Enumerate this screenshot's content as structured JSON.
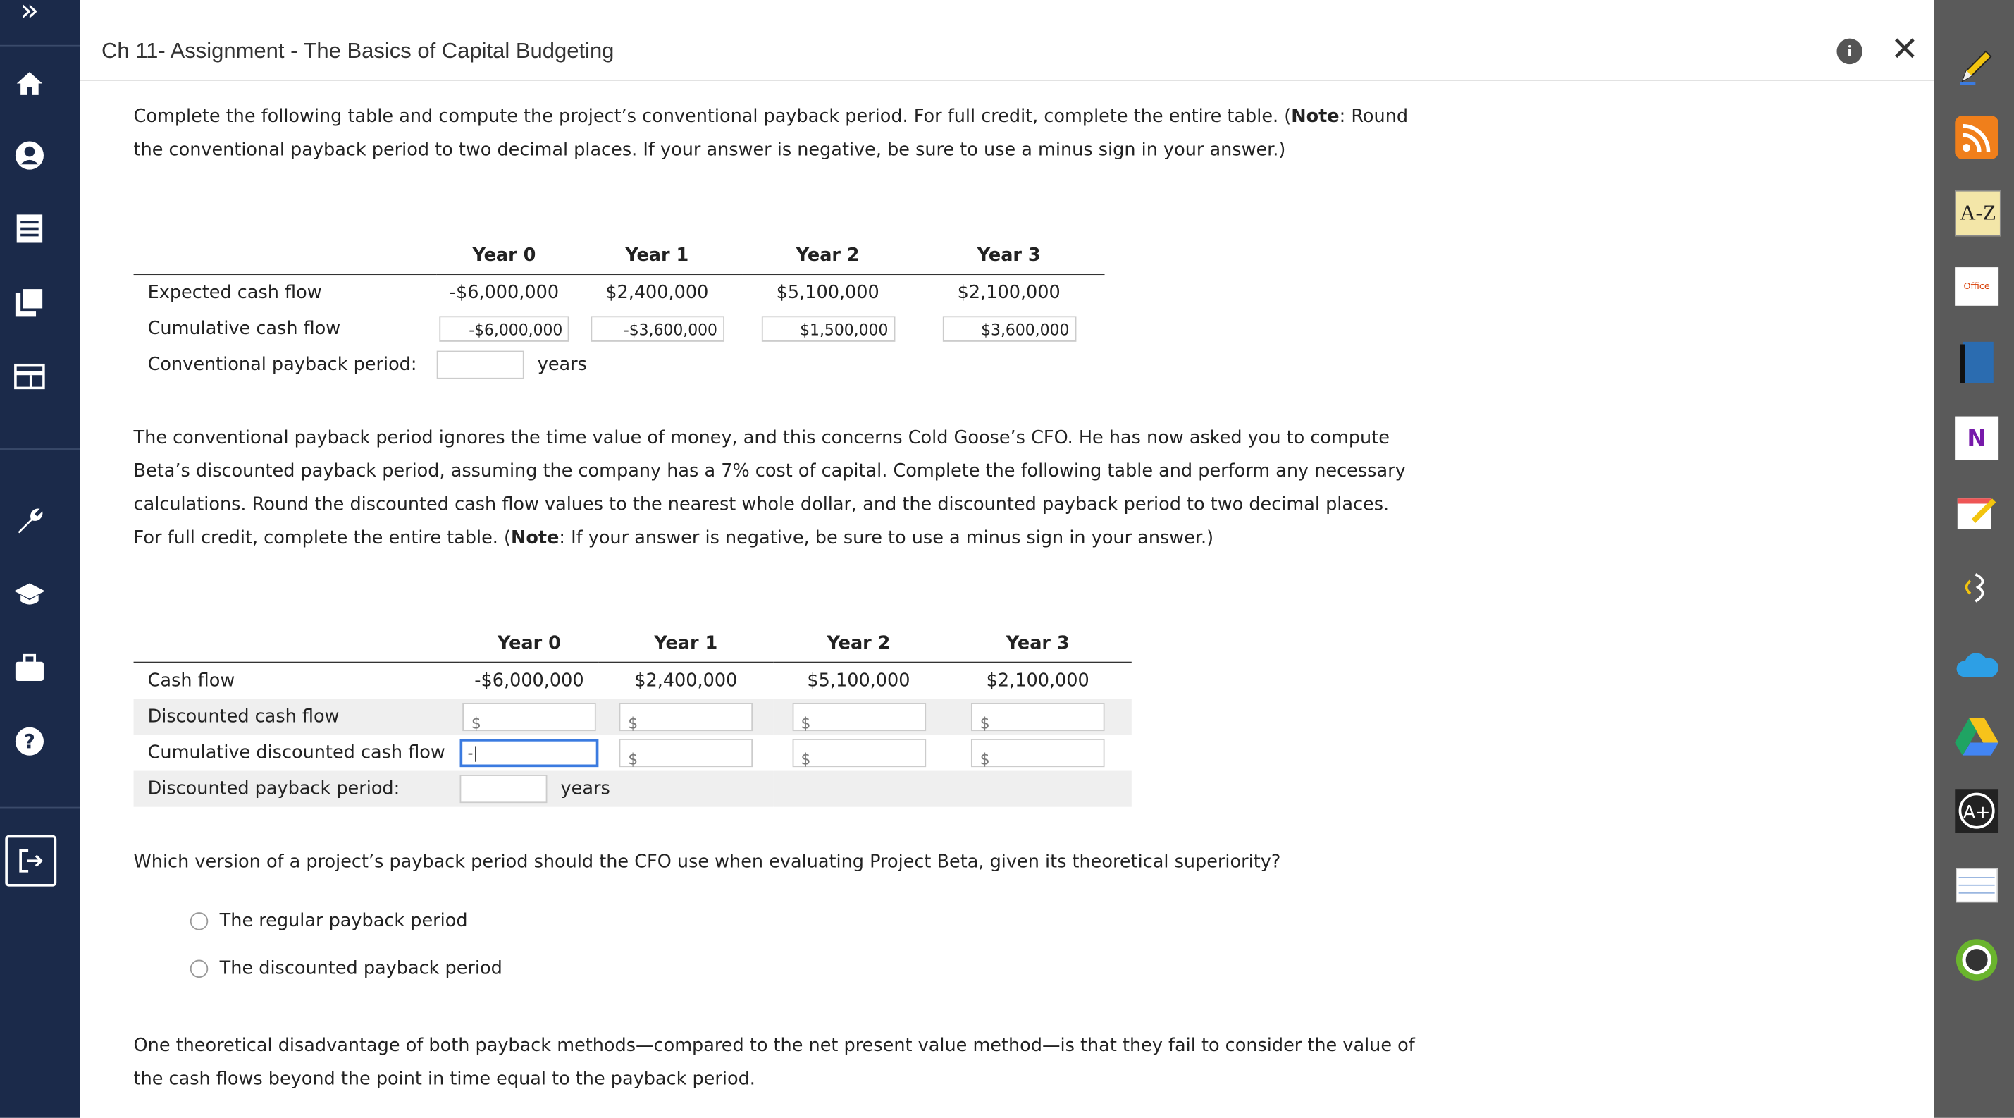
{
  "header": {
    "title": "Ch 11- Assignment - The Basics of Capital Budgeting",
    "info_label": "i",
    "close_label": "✕"
  },
  "left_sidebar": {
    "expand_label": "»",
    "items": [
      "home-icon",
      "profile-icon",
      "list-icon",
      "book-icon",
      "card-icon",
      "wrench-icon",
      "graduation-cap-icon",
      "briefcase-icon",
      "help-icon",
      "exit-icon"
    ]
  },
  "right_sidebar": {
    "items": [
      "pencil-icon",
      "rss-icon",
      "az-dictionary-icon",
      "office-icon",
      "book-app-icon",
      "onenote-icon",
      "note-edit-icon",
      "readspeaker-icon",
      "onedrive-icon",
      "google-drive-icon",
      "grammar-icon",
      "notebook-icon",
      "grade-icon"
    ],
    "az_label": "A-Z",
    "office_label": "Office",
    "onenote_label": "N",
    "grade_label": "A+"
  },
  "intro": {
    "text_a": "Complete the following table and compute the project’s conventional payback period. For full credit, complete the entire table. (",
    "note_bold": "Note",
    "text_b": ": Round the conventional payback period to two decimal places. If your answer is negative, be sure to use a minus sign in your answer.)"
  },
  "table1": {
    "headers": [
      "Year 0",
      "Year 1",
      "Year 2",
      "Year 3"
    ],
    "rows": {
      "expected_label": "Expected cash flow",
      "expected": [
        "-$6,000,000",
        "$2,400,000",
        "$5,100,000",
        "$2,100,000"
      ],
      "cumulative_label": "Cumulative cash flow",
      "cumulative": [
        "-$6,000,000",
        "-$3,600,000",
        "$1,500,000",
        "$3,600,000"
      ],
      "payback_label": "Conventional payback period:",
      "payback_unit": "years",
      "payback_value": ""
    }
  },
  "middle": {
    "text_a": "The conventional payback period ignores the time value of money, and this concerns Cold Goose’s CFO. He has now asked you to compute Beta’s discounted payback period, assuming the company has a 7% cost of capital. Complete the following table and perform any necessary calculations. Round the discounted cash flow values to the nearest whole dollar, and the discounted payback period to two decimal places. For full credit, complete the entire table. (",
    "note_bold": "Note",
    "text_b": ": If your answer is negative, be sure to use a minus sign in your answer.)"
  },
  "table2": {
    "headers": [
      "Year 0",
      "Year 1",
      "Year 2",
      "Year 3"
    ],
    "rows": {
      "cashflow_label": "Cash flow",
      "cashflow": [
        "-$6,000,000",
        "$2,400,000",
        "$5,100,000",
        "$2,100,000"
      ],
      "discounted_label": "Discounted cash flow",
      "cumulative_label": "Cumulative discounted cash flow",
      "cumulative_first_value": "-|",
      "payback_label": "Discounted payback period:",
      "payback_unit": "years"
    },
    "dollar_sign": "$"
  },
  "question": {
    "text": "Which version of a project’s payback period should the CFO use when evaluating Project Beta, given its theoretical superiority?",
    "options": [
      "The regular payback period",
      "The discounted payback period"
    ]
  },
  "closing": {
    "text": "One theoretical disadvantage of both payback methods—compared to the net present value method—is that they fail to consider the value of the cash flows beyond the point in time equal to the payback period."
  }
}
